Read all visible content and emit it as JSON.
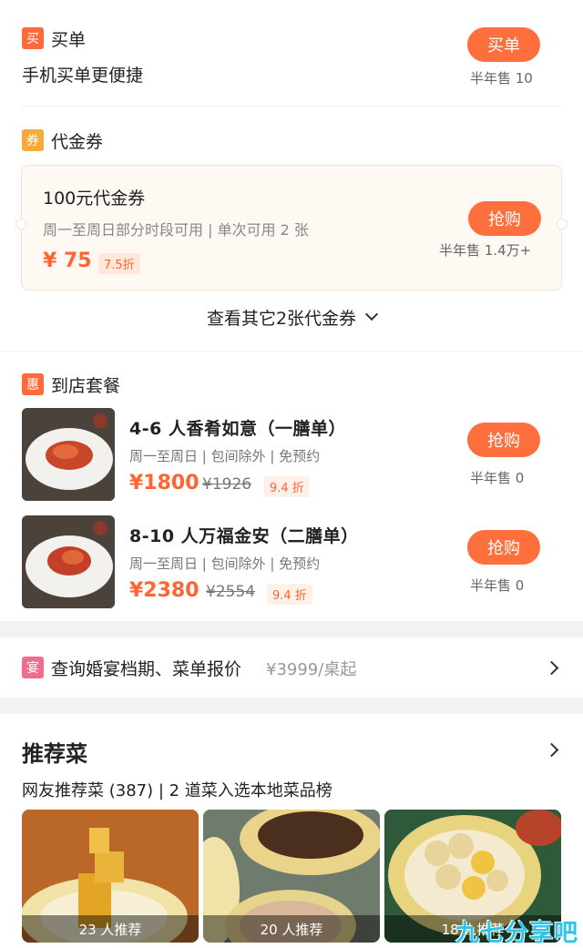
{
  "pay": {
    "tag": "买",
    "title": "买单",
    "subtitle": "手机买单更便捷",
    "button": "买单",
    "sold": "半年售 10"
  },
  "voucher": {
    "tag": "券",
    "title": "代金券",
    "name": "100元代金券",
    "desc": "周一至周日部分时段可用 | 单次可用 2 张",
    "price": "¥ 75",
    "discount": "7.5折",
    "button": "抢购",
    "sold": "半年售 1.4万+",
    "more": "查看其它2张代金券"
  },
  "combo": {
    "tag": "惠",
    "title": "到店套餐",
    "items": [
      {
        "name": "4-6 人香肴如意（一膳单）",
        "desc": "周一至周日 | 包间除外 | 免预约",
        "price": "¥1800",
        "old": "¥1926",
        "discount": "9.4 折",
        "button": "抢购",
        "sold": "半年售 0"
      },
      {
        "name": "8-10 人万福金安（二膳单）",
        "desc": "周一至周日 | 包间除外 | 免预约",
        "price": "¥2380",
        "old": "¥2554",
        "discount": "9.4 折",
        "button": "抢购",
        "sold": "半年售 0"
      }
    ]
  },
  "wedding": {
    "tag": "宴",
    "text": "查询婚宴档期、菜单报价",
    "price": "¥3999/桌起"
  },
  "recommend": {
    "title": "推荐菜",
    "subtitle": "网友推荐菜 (387) | 2 道菜入选本地菜品榜",
    "items": [
      {
        "caption": "23 人推荐"
      },
      {
        "caption": "20 人推荐"
      },
      {
        "caption": "18 人推荐"
      }
    ]
  },
  "watermark": "九七分享吧",
  "colors": {
    "accent": "#ff6f3d",
    "price": "#ff6533",
    "tag_orange": "#ff6a3d",
    "tag_yellow": "#f7a93a",
    "tag_pink": "#f56b8d"
  }
}
